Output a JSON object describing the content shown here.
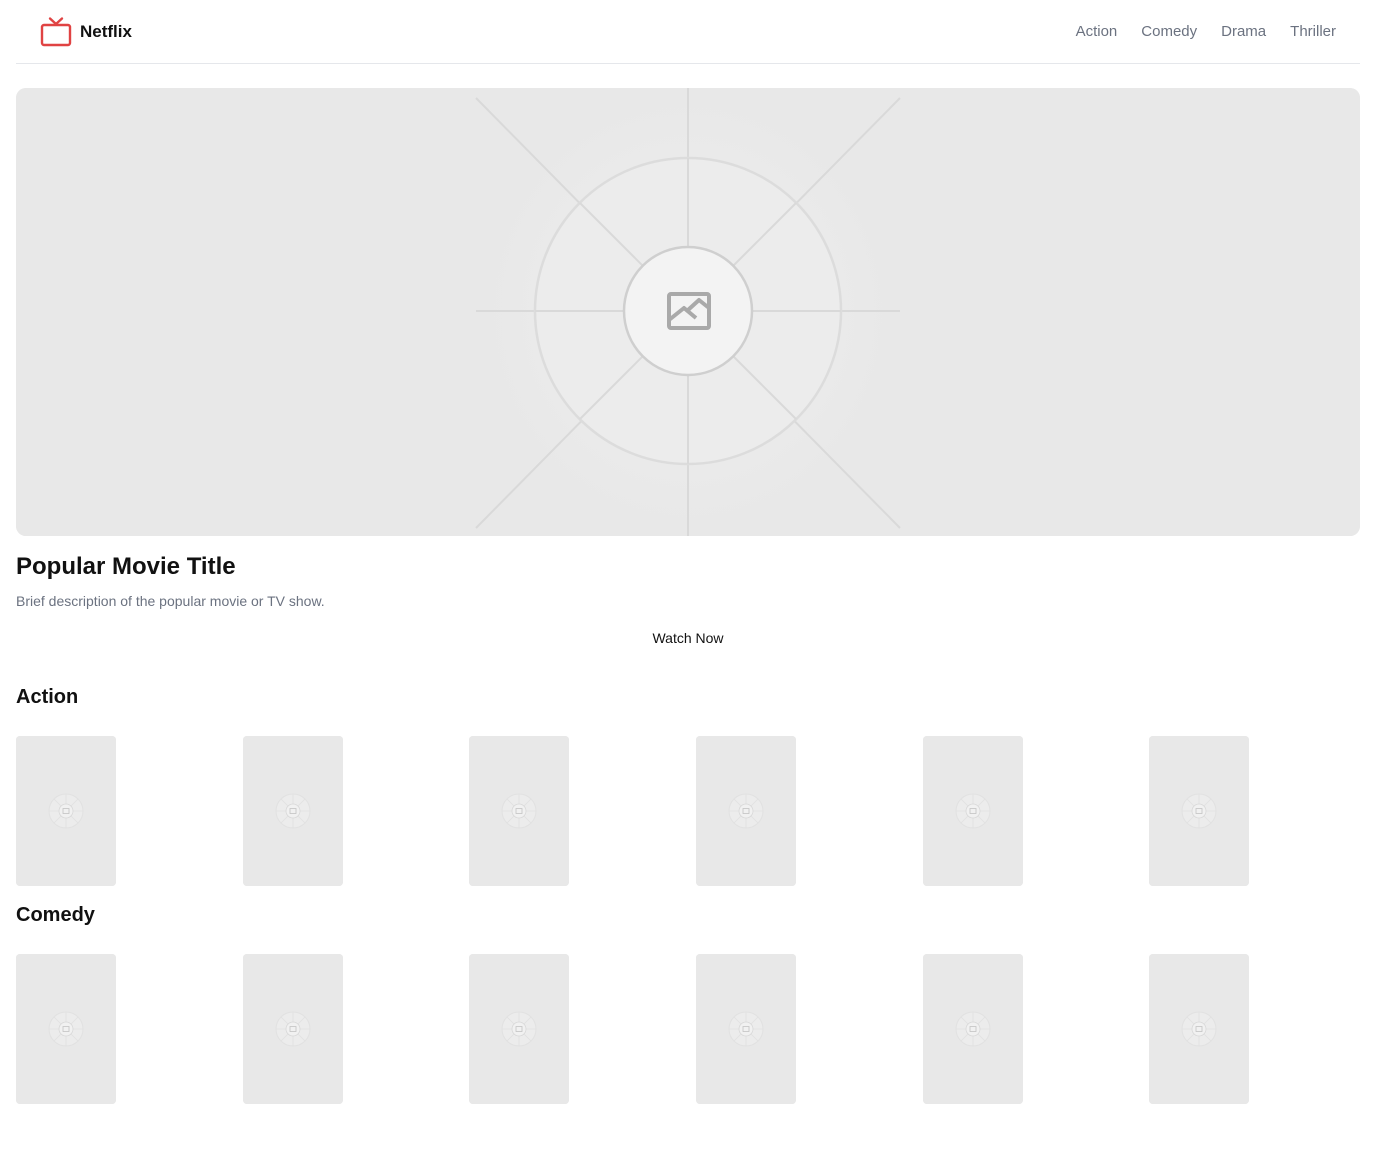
{
  "header": {
    "brand": "Netflix",
    "brand_icon": "tv-icon",
    "brand_color": "#e04343",
    "nav": [
      "Action",
      "Comedy",
      "Drama",
      "Thriller"
    ]
  },
  "hero": {
    "image_icon": "image-placeholder-icon",
    "title": "Popular Movie Title",
    "description": "Brief description of the popular movie or TV show.",
    "cta_label": "Watch Now"
  },
  "rows": [
    {
      "title": "Action",
      "poster_count": 6,
      "poster_icon": "image-placeholder-icon"
    },
    {
      "title": "Comedy",
      "poster_count": 6,
      "poster_icon": "image-placeholder-icon"
    }
  ]
}
